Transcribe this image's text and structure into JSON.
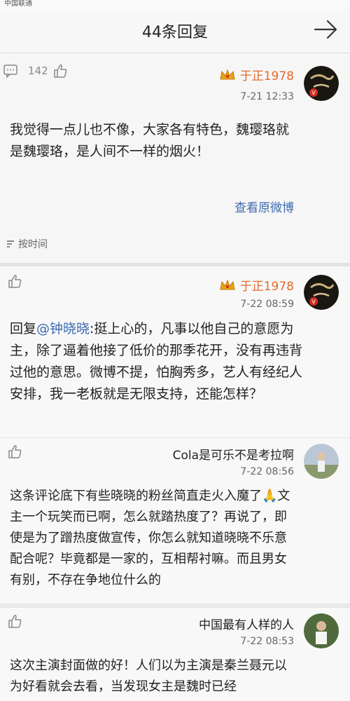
{
  "status_bar": {
    "carrier": "中国联通"
  },
  "header": {
    "title": "44条回复"
  },
  "comments": [
    {
      "user": "于正1978",
      "time": "7-21 12:33",
      "likes": "142",
      "text": "我觉得一点儿也不像，大家各有特色，魏璎珞就是魏璎珞，是人间不一样的烟火！",
      "view_original": "查看原微博"
    },
    {
      "user": "于正1978",
      "time": "7-22 08:59",
      "text_prefix": "回复",
      "mention": "@钟晓晓",
      "text_rest": ":挺上心的，凡事以他自己的意愿为主，除了逼着他接了低价的那季花开，没有再违背过他的意思。微博不提，怕胸秀多，艺人有经纪人安排，我一老板就是无限支持，还能怎样？"
    },
    {
      "user": "Cola是可乐不是考拉啊",
      "time": "7-22 08:56",
      "text": "这条评论底下有些晓晓的粉丝简直走火入魔了🙏文主一个玩笑而已啊，怎么就踏热度了？再说了，即使是为了蹭热度做宣传，你怎么就知道晓晓不乐意配合呢？毕竟都是一家的，互相帮衬嘛。而且男女有别，不存在争地位什么的"
    },
    {
      "user": "中国最有人样的人",
      "time": "7-22 08:53",
      "text": "这次主演封面做的好！人们以为主演是秦兰聂元以为好看就会去看，当发现女主是魏时已经"
    }
  ],
  "sort_label": "按时间",
  "colors": {
    "vip_name": "#e8692c",
    "link": "#3c6ab0",
    "crown": "#e8a317"
  }
}
